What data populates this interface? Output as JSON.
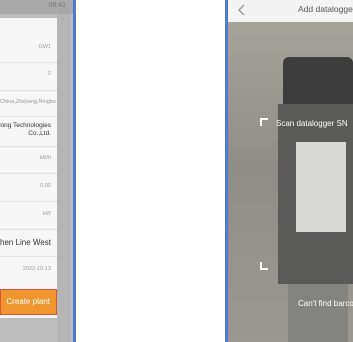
{
  "left_screen": {
    "status_time": "08:41",
    "rows": [
      {
        "value": "GW1"
      },
      {
        "value": "0"
      },
      {
        "value": "China,Zhejiang,Ningbo"
      },
      {
        "value": "Ningbo Ginlong Technologies Co.,Ltd."
      },
      {
        "value": "kWh"
      },
      {
        "value": "0.00"
      },
      {
        "value": "kW"
      },
      {
        "value": "Ninghai Zhen Line West"
      },
      {
        "value": "2022-10-13"
      }
    ],
    "button_label": "Create plant"
  },
  "right_screen": {
    "title": "Add datalogger",
    "scan_text": "Scan datalogger SN",
    "cant_find_text": "Can't find barcode?"
  },
  "colors": {
    "accent_button": "#f0962f",
    "button_border": "#d9533d",
    "panel_edge": "#4a7ccf"
  }
}
